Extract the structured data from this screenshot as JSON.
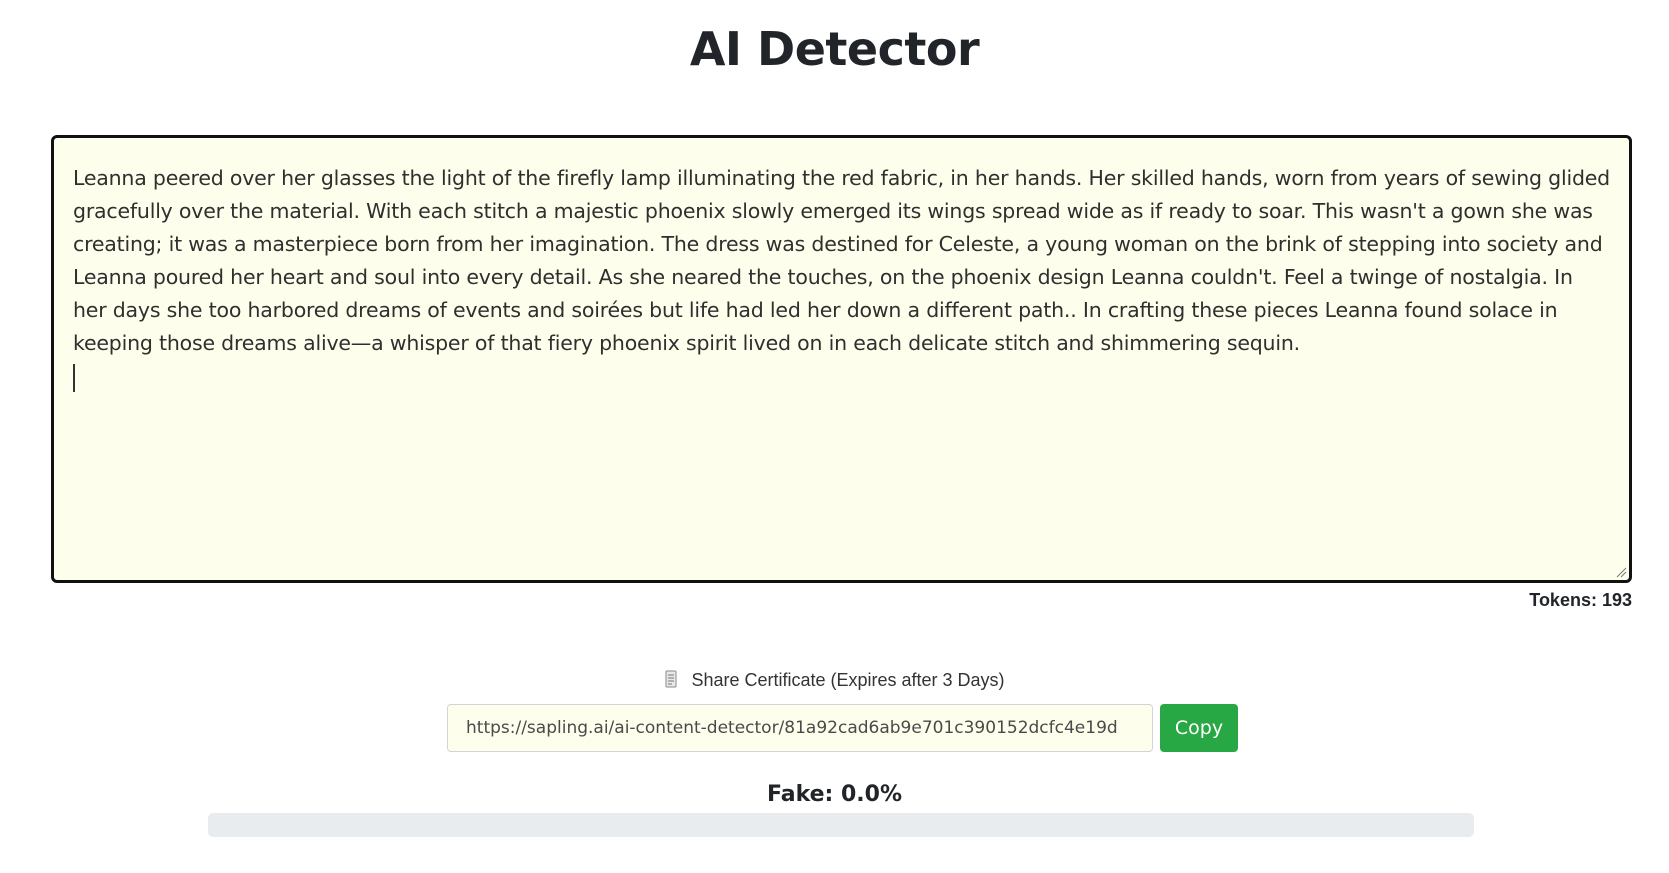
{
  "page": {
    "title": "AI Detector"
  },
  "editor": {
    "text": "Leanna peered over her glasses the light of the firefly lamp illuminating the red fabric, in her hands. Her skilled hands, worn from years of sewing glided gracefully over the material. With each stitch a majestic phoenix slowly emerged its wings spread wide as if ready to soar. This wasn't a gown she was creating; it was a masterpiece born from her imagination. The dress was destined for Celeste, a young woman on the brink of stepping into society and Leanna poured her heart and soul into every detail. As she neared the touches, on the phoenix design Leanna couldn't. Feel a twinge of nostalgia. In her days she too harbored dreams of events and soirées but life had led her down a different path.. In crafting these pieces Leanna found solace in keeping those dreams alive—a whisper of that fiery phoenix spirit lived on in each delicate stitch and shimmering sequin.",
    "background_color": "#fefeec"
  },
  "tokens": {
    "label": "Tokens: 193"
  },
  "certificate": {
    "icon": "scroll-icon",
    "label": "Share Certificate (Expires after 3 Days)",
    "url": "https://sapling.ai/ai-content-detector/81a92cad6ab9e701c390152dcfc4e19d",
    "copy_label": "Copy",
    "copy_color": "#28a745"
  },
  "result": {
    "fake_label": "Fake: 0.0%",
    "fake_fraction": 0.0,
    "track_color": "#e9ecef"
  }
}
